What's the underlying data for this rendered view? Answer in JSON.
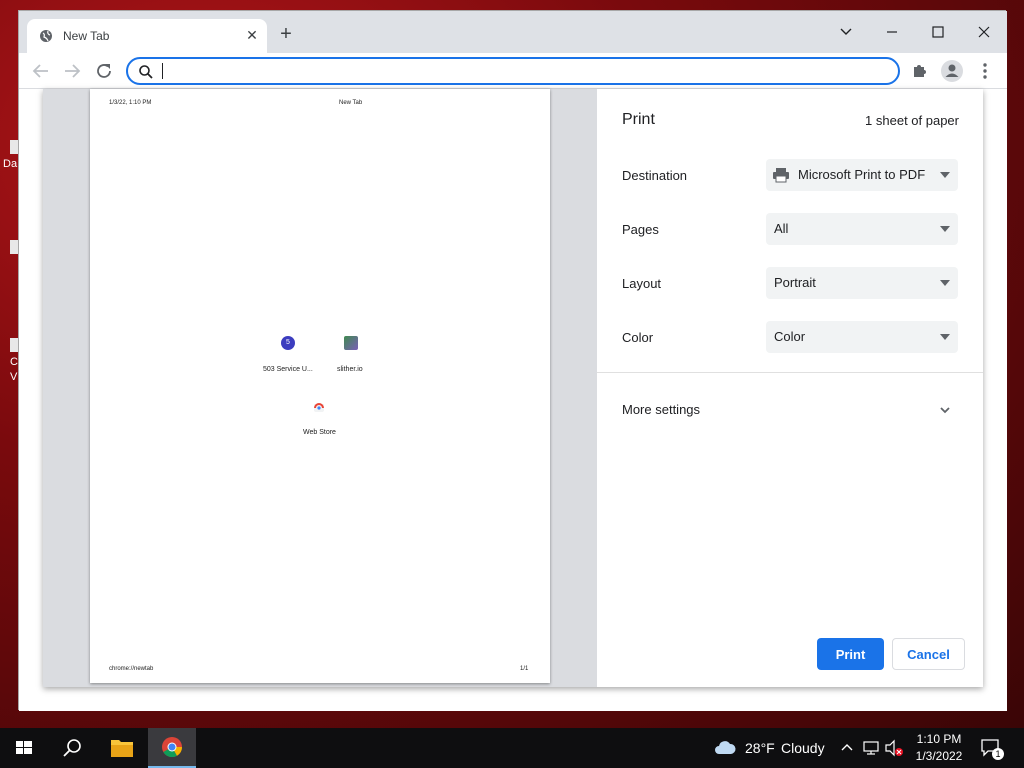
{
  "desktop": {
    "icon_texts": [
      "Da",
      "C",
      "V"
    ]
  },
  "browser": {
    "tab_title": "New Tab",
    "omnibox_value": "",
    "new_tab_symbol": "+",
    "close_symbol": "✕"
  },
  "preview": {
    "header_left": "1/3/22, 1:10 PM",
    "header_center": "New Tab",
    "footer_left": "chrome://newtab",
    "footer_right": "1/1",
    "shortcuts": [
      {
        "label": "503 Service U...",
        "glyph": "5"
      },
      {
        "label": "slither.io"
      },
      {
        "label": "Web Store"
      }
    ]
  },
  "print": {
    "title": "Print",
    "sheets": "1 sheet of paper",
    "destination_label": "Destination",
    "destination_value": "Microsoft Print to PDF",
    "pages_label": "Pages",
    "pages_value": "All",
    "layout_label": "Layout",
    "layout_value": "Portrait",
    "color_label": "Color",
    "color_value": "Color",
    "more_settings": "More settings",
    "print_button": "Print",
    "cancel_button": "Cancel",
    "accent_color": "#1a73e8"
  },
  "taskbar": {
    "weather_temp": "28°F",
    "weather_desc": "Cloudy",
    "time": "1:10 PM",
    "date": "1/3/2022",
    "notification_count": "1"
  }
}
